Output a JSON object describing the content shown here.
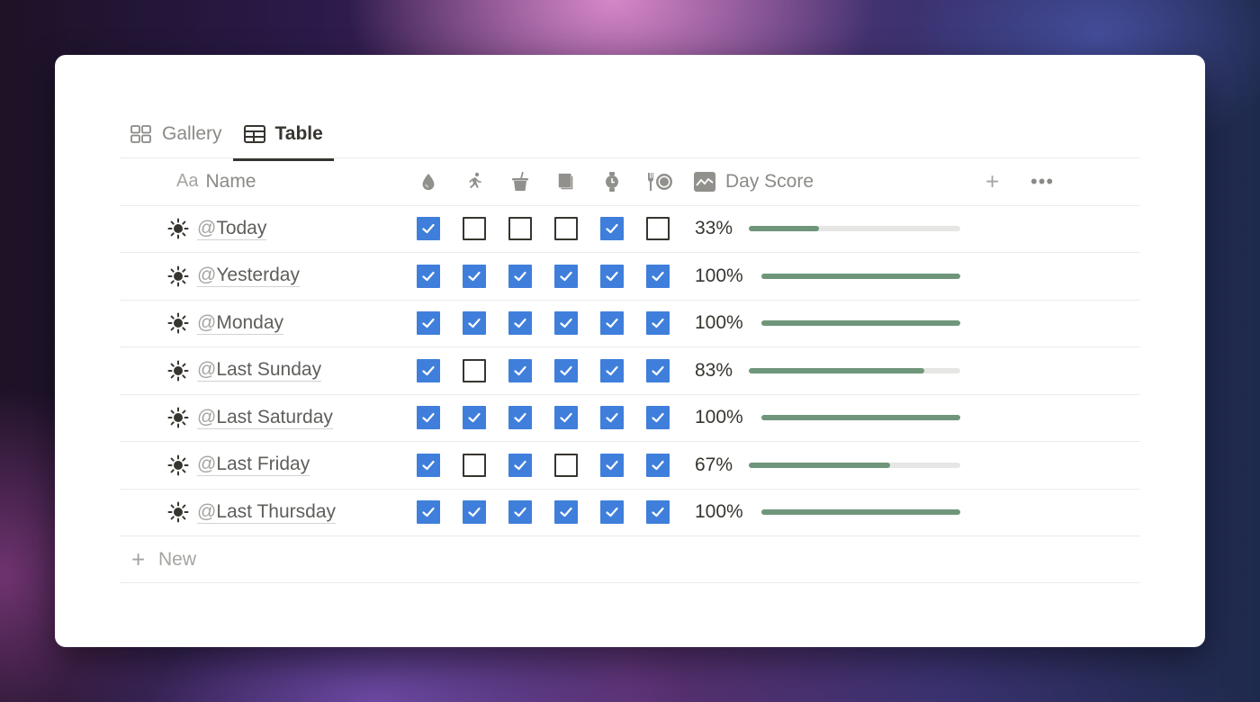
{
  "views": {
    "tabs": [
      {
        "label": "Gallery",
        "icon": "gallery-grid-icon",
        "active": false
      },
      {
        "label": "Table",
        "icon": "table-icon",
        "active": true
      }
    ]
  },
  "table": {
    "header": {
      "name_prefix": "Aa",
      "name_label": "Name",
      "habit_columns": [
        {
          "icon": "water-drop-icon"
        },
        {
          "icon": "running-icon"
        },
        {
          "icon": "drink-cup-icon"
        },
        {
          "icon": "book-pages-icon"
        },
        {
          "icon": "watch-icon"
        },
        {
          "icon": "fork-plate-icon"
        }
      ],
      "score_label": "Day Score",
      "score_icon": "line-chart-icon",
      "add_label": "+",
      "more_label": "•••"
    },
    "rows": [
      {
        "at": "@",
        "name": "Today",
        "checks": [
          true,
          false,
          false,
          false,
          true,
          false
        ],
        "score_label": "33%",
        "score": 0.33
      },
      {
        "at": "@",
        "name": "Yesterday",
        "checks": [
          true,
          true,
          true,
          true,
          true,
          true
        ],
        "score_label": "100%",
        "score": 1.0
      },
      {
        "at": "@",
        "name": "Monday",
        "checks": [
          true,
          true,
          true,
          true,
          true,
          true
        ],
        "score_label": "100%",
        "score": 1.0
      },
      {
        "at": "@",
        "name": "Last Sunday",
        "checks": [
          true,
          false,
          true,
          true,
          true,
          true
        ],
        "score_label": "83%",
        "score": 0.83
      },
      {
        "at": "@",
        "name": "Last Saturday",
        "checks": [
          true,
          true,
          true,
          true,
          true,
          true
        ],
        "score_label": "100%",
        "score": 1.0
      },
      {
        "at": "@",
        "name": "Last Friday",
        "checks": [
          true,
          false,
          true,
          false,
          true,
          true
        ],
        "score_label": "67%",
        "score": 0.67
      },
      {
        "at": "@",
        "name": "Last Thursday",
        "checks": [
          true,
          true,
          true,
          true,
          true,
          true
        ],
        "score_label": "100%",
        "score": 1.0
      }
    ],
    "new_label": "New"
  },
  "colors": {
    "checkbox_checked": "#3f7fdb",
    "progress_fill": "#6f967a",
    "progress_track": "#e6e6e4"
  }
}
